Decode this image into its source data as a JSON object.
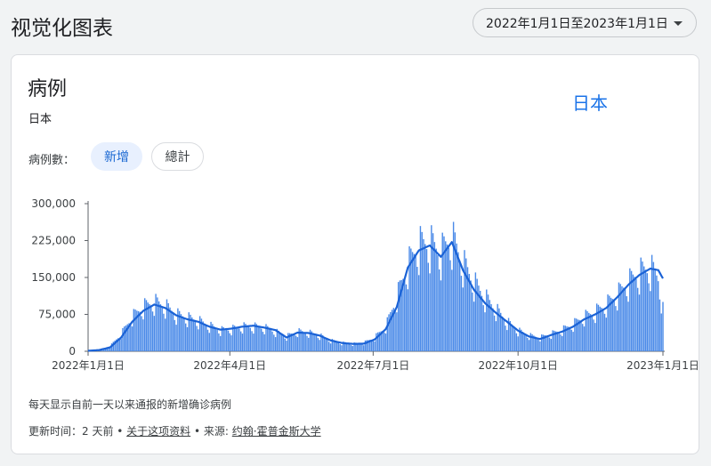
{
  "page": {
    "title": "视觉化图表"
  },
  "date_range": {
    "label": "2022年1月1日至2023年1月1日"
  },
  "card": {
    "title": "病例",
    "region": "日本",
    "region_link": "日本",
    "metric_label": "病例數：",
    "chip_new": "新增",
    "chip_total": "總計",
    "footnote": "每天显示自前一天以来通报的新增确诊病例",
    "updated_prefix": "更新时间：2 天前 • ",
    "about_link": "关于这项资料",
    "source_prefix": " • 来源: ",
    "source_link": "约翰·霍普金斯大学"
  },
  "colors": {
    "bar": "#4a8ae8",
    "line": "#1a62d6",
    "accent": "#1a73e8"
  },
  "chart_data": {
    "type": "bar",
    "title": "",
    "xlabel": "",
    "ylabel": "",
    "ylim": [
      0,
      300000
    ],
    "yticks": [
      0,
      75000,
      150000,
      225000,
      300000
    ],
    "ytick_labels": [
      "0",
      "75,000",
      "150,000",
      "225,000",
      "300,000"
    ],
    "xtick_labels": [
      "2022年1月1日",
      "2022年4月1日",
      "2022年7月1日",
      "2022年10月1日",
      "2023年1月1日"
    ],
    "series": [
      {
        "type": "bar",
        "values_note": "daily new cases (weekly pattern)",
        "anchors": [
          [
            0,
            1000
          ],
          [
            7,
            3000
          ],
          [
            14,
            10000
          ],
          [
            21,
            35000
          ],
          [
            28,
            70000
          ],
          [
            35,
            90000
          ],
          [
            42,
            100000
          ],
          [
            49,
            92000
          ],
          [
            56,
            75000
          ],
          [
            63,
            68000
          ],
          [
            70,
            62000
          ],
          [
            77,
            52000
          ],
          [
            84,
            43000
          ],
          [
            91,
            45000
          ],
          [
            98,
            50000
          ],
          [
            105,
            50000
          ],
          [
            112,
            48000
          ],
          [
            119,
            40000
          ],
          [
            126,
            30000
          ],
          [
            133,
            40000
          ],
          [
            140,
            38000
          ],
          [
            147,
            32000
          ],
          [
            154,
            22000
          ],
          [
            161,
            17000
          ],
          [
            168,
            15000
          ],
          [
            175,
            17000
          ],
          [
            182,
            28000
          ],
          [
            189,
            50000
          ],
          [
            196,
            110000
          ],
          [
            203,
            175000
          ],
          [
            210,
            215000
          ],
          [
            217,
            220000
          ],
          [
            224,
            200000
          ],
          [
            231,
            230000
          ],
          [
            238,
            180000
          ],
          [
            245,
            140000
          ],
          [
            252,
            110000
          ],
          [
            259,
            85000
          ],
          [
            266,
            60000
          ],
          [
            273,
            42000
          ],
          [
            280,
            32000
          ],
          [
            287,
            28000
          ],
          [
            294,
            35000
          ],
          [
            301,
            43000
          ],
          [
            308,
            55000
          ],
          [
            315,
            70000
          ],
          [
            322,
            80000
          ],
          [
            329,
            95000
          ],
          [
            336,
            115000
          ],
          [
            343,
            140000
          ],
          [
            350,
            160000
          ],
          [
            357,
            170000
          ],
          [
            362,
            150000
          ],
          [
            365,
            85000
          ]
        ]
      },
      {
        "type": "line",
        "name": "7-day average",
        "anchors": [
          [
            0,
            1000
          ],
          [
            7,
            2500
          ],
          [
            14,
            8000
          ],
          [
            21,
            28000
          ],
          [
            28,
            60000
          ],
          [
            35,
            82000
          ],
          [
            42,
            95000
          ],
          [
            49,
            88000
          ],
          [
            56,
            73000
          ],
          [
            63,
            65000
          ],
          [
            70,
            60000
          ],
          [
            77,
            50000
          ],
          [
            84,
            44000
          ],
          [
            91,
            46000
          ],
          [
            98,
            50000
          ],
          [
            105,
            52000
          ],
          [
            112,
            48000
          ],
          [
            119,
            43000
          ],
          [
            126,
            28000
          ],
          [
            133,
            38000
          ],
          [
            140,
            37000
          ],
          [
            147,
            32000
          ],
          [
            154,
            22000
          ],
          [
            161,
            17000
          ],
          [
            168,
            15000
          ],
          [
            175,
            15500
          ],
          [
            182,
            24000
          ],
          [
            189,
            45000
          ],
          [
            196,
            90000
          ],
          [
            203,
            170000
          ],
          [
            210,
            205000
          ],
          [
            217,
            215000
          ],
          [
            224,
            192000
          ],
          [
            231,
            222000
          ],
          [
            238,
            165000
          ],
          [
            245,
            125000
          ],
          [
            252,
            98000
          ],
          [
            259,
            78000
          ],
          [
            266,
            60000
          ],
          [
            273,
            42000
          ],
          [
            280,
            30000
          ],
          [
            287,
            25000
          ],
          [
            294,
            33000
          ],
          [
            301,
            40000
          ],
          [
            308,
            50000
          ],
          [
            315,
            65000
          ],
          [
            322,
            75000
          ],
          [
            329,
            88000
          ],
          [
            336,
            110000
          ],
          [
            343,
            135000
          ],
          [
            350,
            155000
          ],
          [
            357,
            168000
          ],
          [
            362,
            165000
          ],
          [
            365,
            148000
          ]
        ]
      }
    ]
  }
}
